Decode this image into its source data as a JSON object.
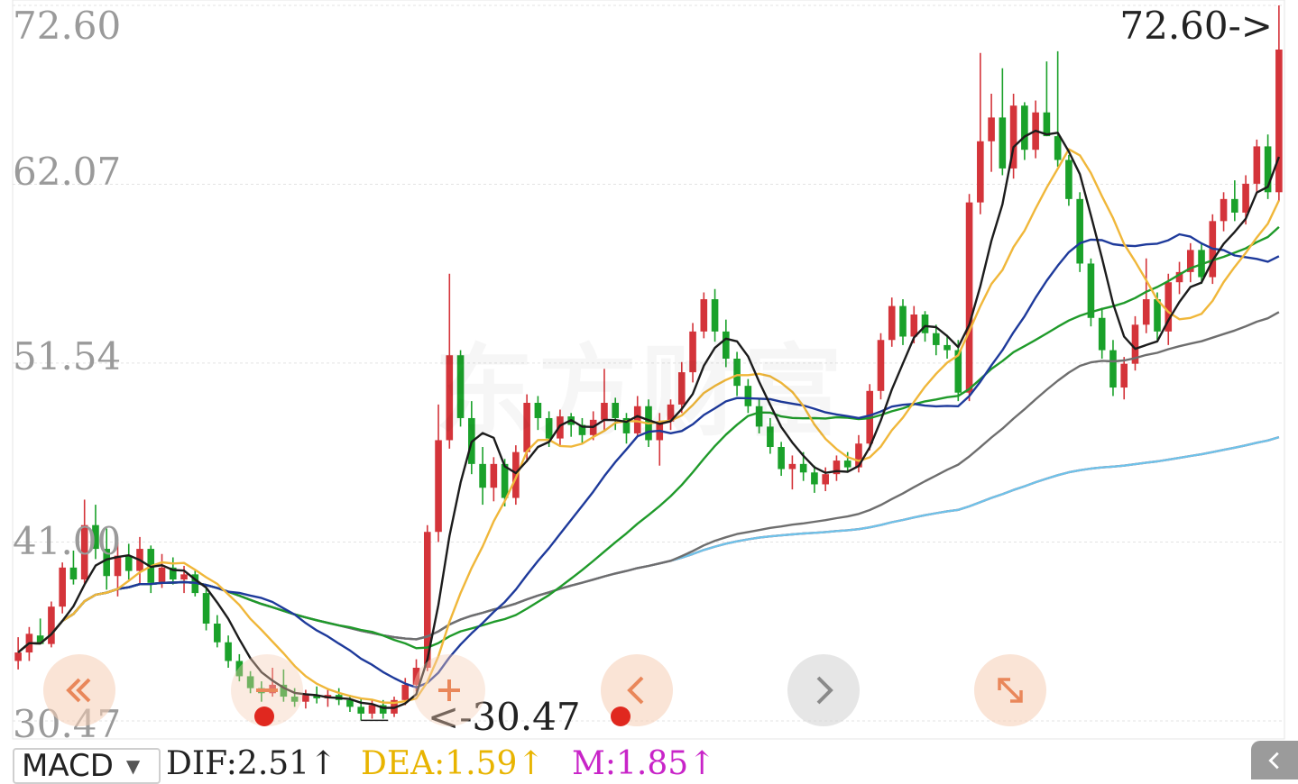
{
  "chart_data": {
    "type": "candlestick",
    "y_axis": {
      "ticks": [
        "72.60",
        "62.07",
        "51.54",
        "41.00",
        "30.47"
      ],
      "min": 30.47,
      "max": 72.6
    },
    "max_marker": "72.60->",
    "min_marker": "<-30.47",
    "watermark": "东方财富",
    "candles": [
      [
        34.0,
        35.4,
        33.5,
        34.5
      ],
      [
        34.5,
        36.0,
        34.0,
        35.6
      ],
      [
        35.5,
        36.5,
        35.0,
        35.0
      ],
      [
        35.0,
        37.5,
        34.8,
        37.2
      ],
      [
        37.2,
        39.8,
        36.8,
        39.5
      ],
      [
        39.5,
        40.5,
        38.5,
        38.8
      ],
      [
        38.8,
        43.5,
        38.5,
        42.0
      ],
      [
        42.0,
        43.2,
        40.0,
        40.6
      ],
      [
        40.6,
        41.8,
        38.2,
        39.0
      ],
      [
        39.0,
        41.0,
        37.8,
        40.2
      ],
      [
        40.2,
        40.9,
        38.8,
        39.3
      ],
      [
        39.3,
        41.3,
        38.5,
        40.6
      ],
      [
        40.6,
        40.8,
        38.0,
        38.6
      ],
      [
        38.6,
        40.3,
        38.3,
        39.5
      ],
      [
        39.5,
        40.1,
        38.5,
        38.8
      ],
      [
        38.8,
        39.6,
        38.0,
        39.1
      ],
      [
        39.1,
        39.4,
        37.8,
        38.0
      ],
      [
        38.0,
        38.3,
        35.8,
        36.2
      ],
      [
        36.2,
        36.7,
        34.8,
        35.1
      ],
      [
        35.1,
        35.5,
        33.6,
        34.0
      ],
      [
        34.0,
        34.4,
        32.8,
        33.1
      ],
      [
        33.1,
        33.4,
        32.1,
        32.4
      ],
      [
        32.4,
        32.8,
        31.6,
        32.1
      ],
      [
        32.1,
        33.6,
        31.9,
        32.6
      ],
      [
        32.6,
        33.5,
        31.6,
        31.9
      ],
      [
        31.9,
        32.4,
        31.3,
        31.6
      ],
      [
        31.6,
        32.3,
        31.2,
        32.0
      ],
      [
        32.0,
        32.5,
        31.5,
        31.8
      ],
      [
        31.8,
        32.3,
        31.3,
        32.0
      ],
      [
        32.0,
        32.4,
        31.4,
        31.7
      ],
      [
        31.7,
        32.0,
        31.0,
        31.3
      ],
      [
        31.3,
        31.8,
        30.5,
        30.9
      ],
      [
        30.9,
        31.7,
        30.6,
        31.4
      ],
      [
        31.4,
        31.7,
        30.6,
        30.9
      ],
      [
        30.9,
        31.9,
        30.7,
        31.7
      ],
      [
        31.7,
        33.0,
        31.4,
        32.6
      ],
      [
        32.6,
        34.1,
        32.2,
        33.6
      ],
      [
        33.6,
        42.0,
        33.4,
        41.6
      ],
      [
        41.6,
        49.1,
        41.0,
        47.0
      ],
      [
        47.0,
        56.8,
        46.5,
        52.0
      ],
      [
        52.0,
        52.3,
        47.8,
        48.3
      ],
      [
        48.3,
        49.3,
        45.0,
        45.6
      ],
      [
        45.6,
        46.6,
        43.2,
        44.2
      ],
      [
        44.2,
        46.0,
        43.4,
        45.6
      ],
      [
        45.6,
        45.9,
        43.1,
        43.6
      ],
      [
        43.6,
        46.7,
        43.2,
        46.3
      ],
      [
        46.3,
        49.7,
        45.7,
        49.2
      ],
      [
        49.2,
        49.6,
        47.6,
        48.3
      ],
      [
        48.3,
        48.7,
        46.6,
        47.1
      ],
      [
        47.1,
        48.8,
        46.7,
        48.4
      ],
      [
        48.4,
        48.6,
        47.2,
        47.9
      ],
      [
        47.9,
        48.3,
        46.8,
        47.3
      ],
      [
        47.3,
        48.7,
        47.0,
        48.2
      ],
      [
        48.2,
        51.2,
        47.6,
        49.2
      ],
      [
        49.2,
        49.5,
        47.6,
        48.3
      ],
      [
        48.3,
        48.6,
        46.8,
        47.4
      ],
      [
        47.4,
        49.6,
        47.2,
        49.0
      ],
      [
        49.0,
        49.4,
        46.6,
        47.0
      ],
      [
        47.0,
        48.6,
        45.5,
        48.1
      ],
      [
        48.1,
        49.4,
        47.6,
        49.1
      ],
      [
        49.1,
        51.6,
        48.6,
        51.0
      ],
      [
        51.0,
        53.9,
        50.4,
        53.4
      ],
      [
        53.4,
        55.7,
        53.0,
        55.3
      ],
      [
        55.3,
        55.9,
        52.8,
        53.4
      ],
      [
        53.4,
        54.1,
        51.3,
        51.8
      ],
      [
        51.8,
        52.2,
        49.6,
        50.2
      ],
      [
        50.2,
        50.6,
        48.6,
        49.0
      ],
      [
        49.0,
        49.4,
        47.4,
        47.8
      ],
      [
        47.8,
        48.3,
        46.2,
        46.6
      ],
      [
        46.6,
        46.9,
        44.9,
        45.3
      ],
      [
        45.3,
        46.1,
        44.1,
        45.6
      ],
      [
        45.6,
        46.3,
        44.6,
        45.1
      ],
      [
        45.1,
        45.5,
        43.9,
        44.4
      ],
      [
        44.4,
        45.4,
        44.0,
        45.0
      ],
      [
        45.0,
        46.1,
        44.6,
        45.8
      ],
      [
        45.8,
        46.3,
        45.1,
        45.4
      ],
      [
        45.4,
        47.3,
        45.1,
        46.8
      ],
      [
        46.8,
        50.3,
        46.4,
        49.9
      ],
      [
        49.9,
        53.3,
        49.4,
        52.9
      ],
      [
        52.9,
        55.4,
        52.5,
        54.9
      ],
      [
        54.9,
        55.3,
        52.6,
        53.1
      ],
      [
        53.1,
        54.9,
        52.7,
        54.4
      ],
      [
        54.4,
        54.6,
        52.8,
        53.3
      ],
      [
        53.3,
        53.8,
        52.0,
        52.6
      ],
      [
        52.6,
        53.2,
        51.8,
        52.3
      ],
      [
        52.3,
        52.9,
        49.3,
        49.8
      ],
      [
        49.8,
        61.5,
        49.3,
        61.0
      ],
      [
        61.0,
        69.8,
        60.3,
        64.6
      ],
      [
        64.6,
        67.4,
        62.8,
        66.0
      ],
      [
        66.0,
        68.9,
        62.6,
        63.0
      ],
      [
        63.0,
        67.4,
        62.4,
        66.7
      ],
      [
        66.7,
        66.9,
        63.5,
        64.1
      ],
      [
        64.1,
        67.0,
        63.6,
        66.3
      ],
      [
        66.3,
        69.3,
        64.9,
        64.9
      ],
      [
        64.9,
        69.9,
        63.1,
        63.5
      ],
      [
        63.5,
        63.8,
        60.8,
        61.2
      ],
      [
        61.2,
        61.6,
        56.9,
        57.4
      ],
      [
        57.4,
        57.7,
        53.7,
        54.2
      ],
      [
        54.2,
        54.8,
        51.8,
        52.3
      ],
      [
        52.3,
        52.9,
        49.6,
        50.1
      ],
      [
        50.1,
        51.9,
        49.4,
        51.5
      ],
      [
        51.5,
        54.3,
        51.1,
        53.8
      ],
      [
        53.8,
        57.7,
        53.3,
        55.3
      ],
      [
        55.3,
        55.7,
        52.9,
        53.4
      ],
      [
        53.4,
        56.8,
        52.6,
        56.3
      ],
      [
        56.3,
        57.5,
        55.6,
        56.9
      ],
      [
        56.9,
        58.6,
        56.3,
        58.2
      ],
      [
        58.2,
        58.6,
        56.2,
        56.6
      ],
      [
        56.6,
        60.3,
        56.2,
        59.9
      ],
      [
        59.9,
        61.6,
        59.3,
        61.2
      ],
      [
        61.2,
        62.3,
        59.9,
        60.4
      ],
      [
        60.4,
        62.6,
        59.7,
        62.1
      ],
      [
        62.1,
        64.7,
        61.6,
        64.3
      ],
      [
        64.3,
        65.0,
        61.2,
        61.6
      ],
      [
        61.6,
        72.6,
        61.1,
        70.0
      ]
    ]
  },
  "lower_bar": {
    "indicator": "MACD",
    "dif": "DIF:2.51↑",
    "dea": "DEA:1.59↑",
    "m": "M:1.85↑"
  },
  "colors": {
    "up": "#d4343a",
    "down": "#1aa12a",
    "ma5": "#1c1c1c",
    "ma10": "#f0b73a",
    "ma20": "#1e3a9b",
    "ma30": "#1f9a2a",
    "ma60": "#6e6e6e",
    "ma120": "#6ec3ea",
    "ma250": "#c0262b",
    "dif": "#222222",
    "dea": "#e8b400",
    "m": "#c824c8"
  },
  "nav_icons": [
    "double-left-icon",
    "left-icon",
    "right-icon",
    "expand-icon"
  ]
}
